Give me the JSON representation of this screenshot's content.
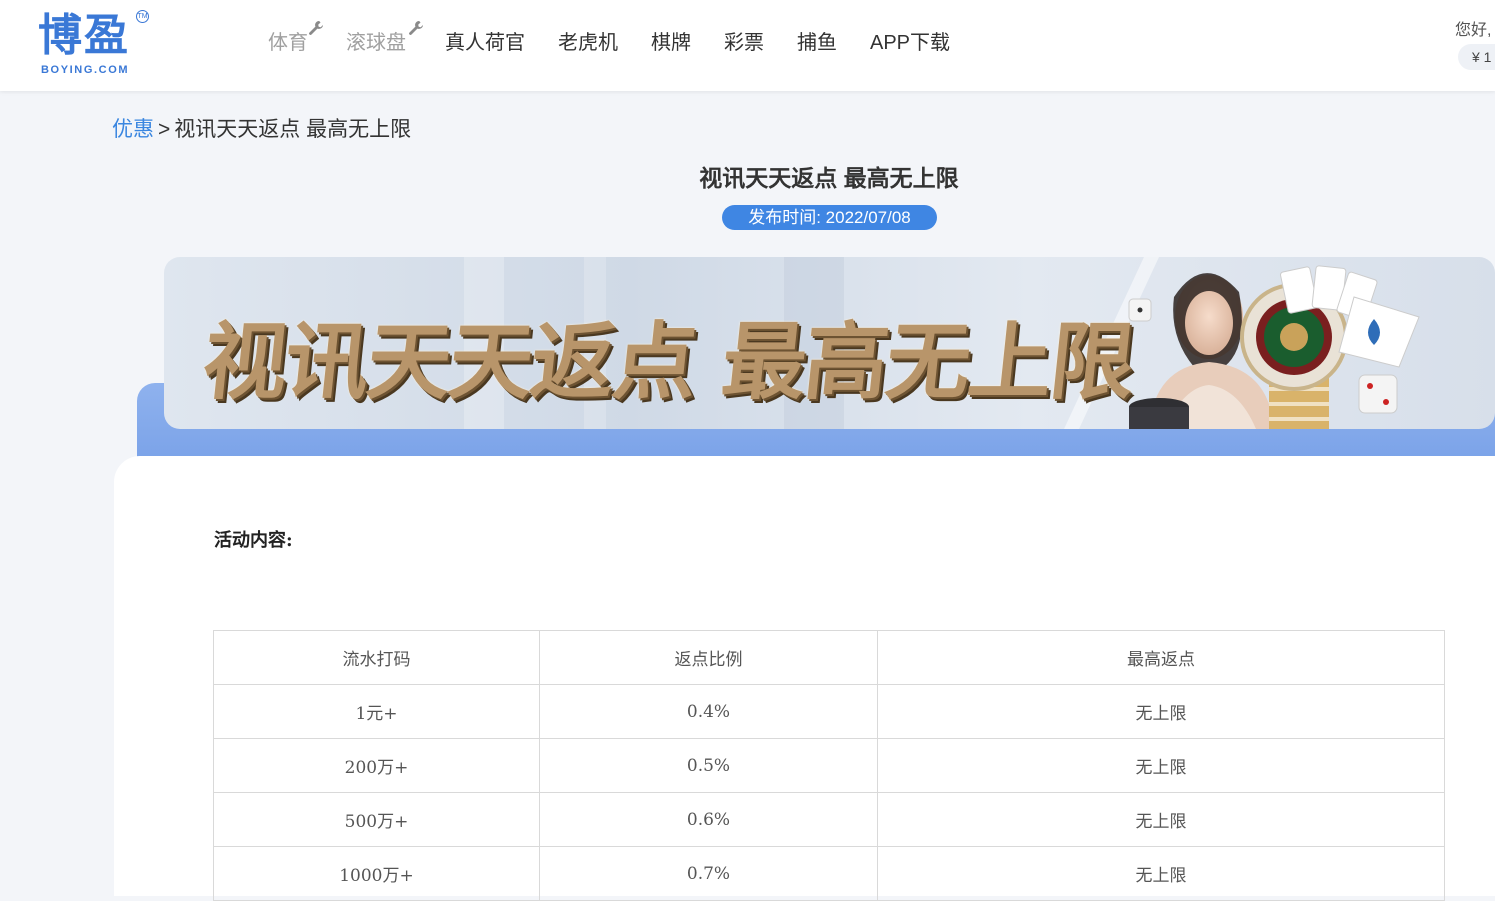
{
  "brand": {
    "name_cn": "博盈",
    "name_en": "BOYING.COM",
    "tm": "TM",
    "color": "#3a78d6"
  },
  "nav": {
    "items": [
      {
        "label": "体育",
        "disabled": true,
        "icon": "wrench-icon"
      },
      {
        "label": "滚球盘",
        "disabled": true,
        "icon": "wrench-icon"
      },
      {
        "label": "真人荷官",
        "disabled": false
      },
      {
        "label": "老虎机",
        "disabled": false
      },
      {
        "label": "棋牌",
        "disabled": false
      },
      {
        "label": "彩票",
        "disabled": false
      },
      {
        "label": "捕鱼",
        "disabled": false
      },
      {
        "label": "APP下载",
        "disabled": false
      }
    ]
  },
  "user": {
    "greeting": "您好,",
    "balance": "¥ 1"
  },
  "breadcrumb": {
    "link": "优惠",
    "separator": ">",
    "current": "视讯天天返点 最高无上限"
  },
  "article": {
    "title": "视讯天天返点 最高无上限",
    "published": "发布时间: 2022/07/08",
    "banner_text": "视讯天天返点 最高无上限",
    "section_label": "活动内容:"
  },
  "table": {
    "headers": [
      "流水打码",
      "返点比例",
      "最高返点"
    ],
    "rows": [
      [
        "1元+",
        "0.4%",
        "无上限"
      ],
      [
        "200万+",
        "0.5%",
        "无上限"
      ],
      [
        "500万+",
        "0.6%",
        "无上限"
      ],
      [
        "1000万+",
        "0.7%",
        "无上限"
      ]
    ]
  },
  "colors": {
    "accent": "#3f86e3",
    "link": "#3a86e0",
    "band": "#7aa2e8",
    "gold": "#b8956a"
  }
}
